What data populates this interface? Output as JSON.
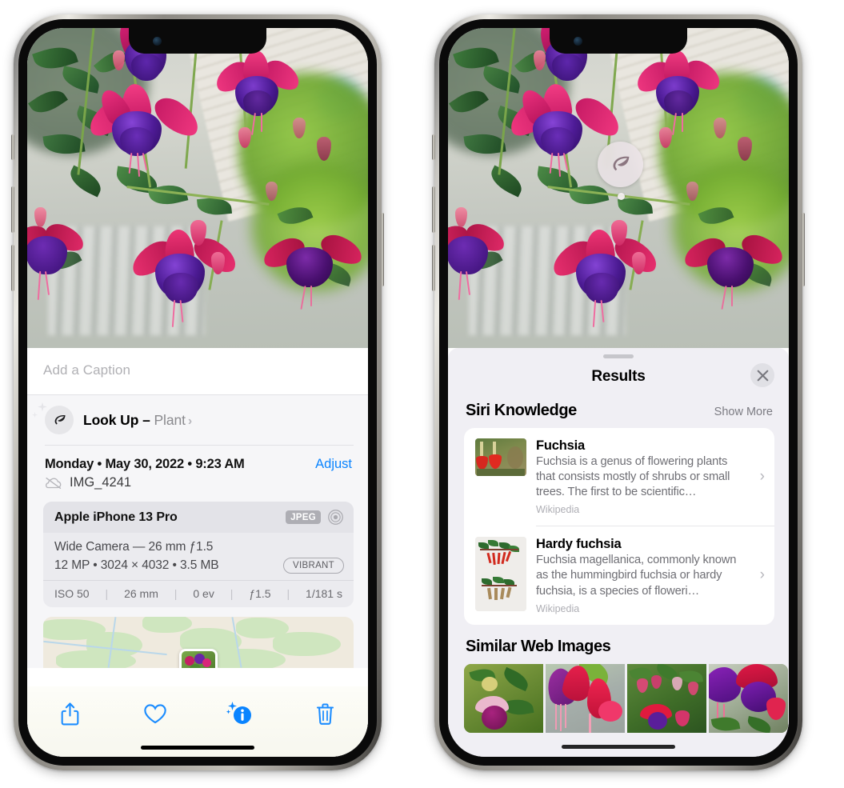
{
  "left_phone": {
    "name": "iPhone photo detail view",
    "caption_placeholder": "Add a Caption",
    "lookup": {
      "icon": "leaf-sparkle-icon",
      "label": "Look Up",
      "dash": "–",
      "subject": "Plant",
      "chevron": "›"
    },
    "metadata": {
      "date_line": "Monday • May 30, 2022 • 9:23 AM",
      "adjust_label": "Adjust",
      "cloud_icon": "cloud-slash-icon",
      "filename": "IMG_4241"
    },
    "exif": {
      "device": "Apple iPhone 13 Pro",
      "format_badge": "JPEG",
      "aperture_icon": "aperture-icon",
      "lens_line": "Wide Camera — 26 mm ƒ1.5",
      "size_line": "12 MP • 3024 × 4032 • 3.5 MB",
      "style_badge": "VIBRANT",
      "settings": [
        "ISO 50",
        "26 mm",
        "0 ev",
        "ƒ1.5",
        "1/181 s"
      ]
    },
    "toolbar": [
      {
        "name": "share-button",
        "icon": "share-icon"
      },
      {
        "name": "favorite-button",
        "icon": "heart-icon"
      },
      {
        "name": "info-button",
        "icon": "info-sparkle-icon"
      },
      {
        "name": "delete-button",
        "icon": "trash-icon"
      }
    ],
    "accent_color": "#0a84ff"
  },
  "right_phone": {
    "name": "Visual Look Up results sheet",
    "photo_badge": {
      "icon": "leaf-icon",
      "name": "visual-lookup-badge"
    },
    "sheet": {
      "title": "Results",
      "close_icon": "close-x-icon"
    },
    "siri_knowledge": {
      "heading": "Siri Knowledge",
      "action": "Show More",
      "items": [
        {
          "title": "Fuchsia",
          "description": "Fuchsia is a genus of flowering plants that consists mostly of shrubs or small trees. The first to be scientific…",
          "source": "Wikipedia",
          "thumbnail": "fuchsia-red-flowers-thumbnail",
          "chevron": "›"
        },
        {
          "title": "Hardy fuchsia",
          "description": "Fuchsia magellanica, commonly known as the hummingbird fuchsia or hardy fuchsia, is a species of floweri…",
          "source": "Wikipedia",
          "thumbnail": "hardy-fuchsia-specimen-thumbnail",
          "chevron": "›"
        }
      ]
    },
    "similar_web_images": {
      "heading": "Similar Web Images",
      "tiles": [
        {
          "name": "web-image-1",
          "alt": "pink and magenta fuchsia with green leaves"
        },
        {
          "name": "web-image-2",
          "alt": "red and magenta fuchsia close-up"
        },
        {
          "name": "web-image-3",
          "alt": "fuchsia bush with buds"
        },
        {
          "name": "web-image-4",
          "alt": "purple and red fuchsia blooms"
        }
      ]
    },
    "panel_color": "#f0eff4"
  },
  "photo": {
    "subject": "Fuchsia flowers hanging basket",
    "colors": {
      "sepal_pink": "#ee2b7b",
      "corolla_purple": "#5b1f9e",
      "leaf_green": "#2f6b35",
      "background_green": "#7fb339"
    }
  }
}
